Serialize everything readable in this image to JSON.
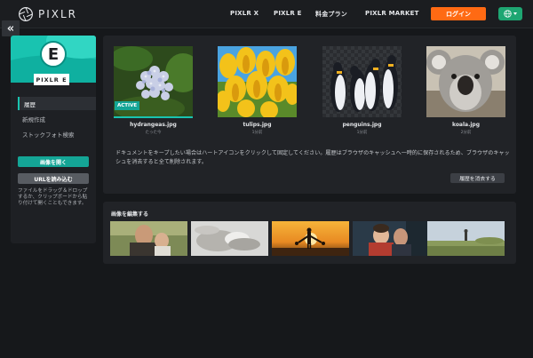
{
  "app": {
    "brand_name": "PIXLR",
    "product_badge": "PIXLR E",
    "product_letter": "E"
  },
  "nav": {
    "items": [
      "PIXLR X",
      "PIXLR E",
      "料金プラン",
      "PIXLR MARKET"
    ],
    "login_label": "ログイン",
    "collapse_glyph": "«"
  },
  "sidebar": {
    "items": [
      "履歴",
      "新規作成",
      "ストックフォト検索"
    ],
    "active_index": 0,
    "open_image_label": "画像を開く",
    "load_url_label": "URLを読み込む",
    "drop_hint": "ファイルをドラッグ＆ドロップするか、クリップボードから貼り付けて開くこともできます。"
  },
  "history": {
    "active_tag": "ACTIVE",
    "items": [
      {
        "name": "hydrangeas.jpg",
        "age": "たった今",
        "active": true
      },
      {
        "name": "tulips.jpg",
        "age": "1分前",
        "active": false
      },
      {
        "name": "penguins.jpg",
        "age": "1分前",
        "active": false
      },
      {
        "name": "koala.jpg",
        "age": "2分前",
        "active": false
      }
    ],
    "info_text": "ドキュメントをキープしたい場合はハートアイコンをクリックして固定してください。履歴はブラウザのキャッシュへ一時的に保存されるため、ブラウザのキャッシュを消去すると全て削除されます。",
    "clear_label": "履歴を消去する"
  },
  "edit": {
    "title": "画像を編集する",
    "photos": [
      "father-and-child-photo",
      "hands-photo",
      "sunset-family-photo",
      "child-and-man-photo",
      "field-figure-photo"
    ]
  },
  "colors": {
    "accent": "#19c3b0",
    "login": "#ff6a13",
    "lang": "#1ea672"
  }
}
